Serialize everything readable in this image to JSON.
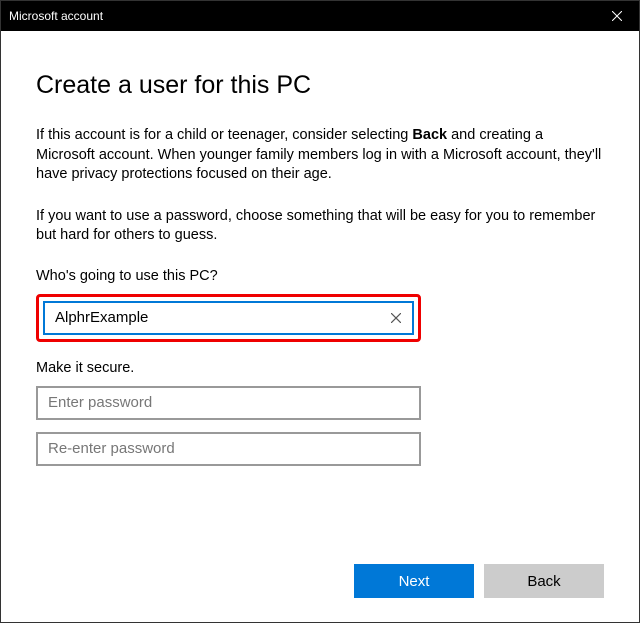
{
  "titlebar": {
    "title": "Microsoft account"
  },
  "heading": "Create a user for this PC",
  "desc1_pre": "If this account is for a child or teenager, consider selecting ",
  "desc1_bold": "Back",
  "desc1_post": " and creating a Microsoft account. When younger family members log in with a Microsoft account, they'll have privacy protections focused on their age.",
  "desc2": "If you want to use a password, choose something that will be easy for you to remember but hard for others to guess.",
  "form": {
    "username_label": "Who's going to use this PC?",
    "username_value": "AlphrExample",
    "secure_label": "Make it secure.",
    "password_placeholder": "Enter password",
    "repassword_placeholder": "Re-enter password"
  },
  "buttons": {
    "next": "Next",
    "back": "Back"
  }
}
